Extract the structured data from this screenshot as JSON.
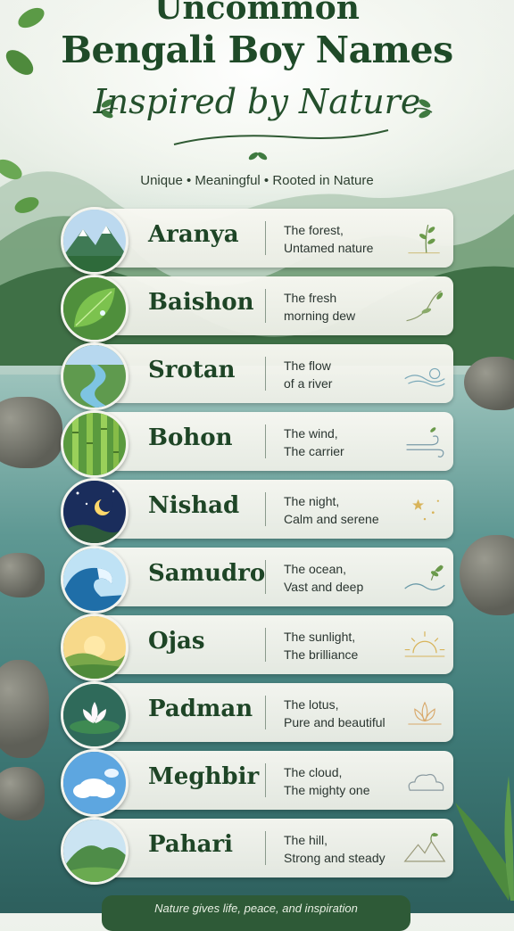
{
  "header": {
    "title_line1": "Uncommon",
    "title_line2": "Bengali Boy Names",
    "title_line3": "Inspired by Nature",
    "tagline": "Unique • Meaningful • Rooted in Nature"
  },
  "names": [
    {
      "name": "Aranya",
      "meaning_line1": "The forest,",
      "meaning_line2": "Untamed nature",
      "image_icon": "mountain-forest-icon",
      "deco_icon": "sprig-icon"
    },
    {
      "name": "Baishon",
      "meaning_line1": "The fresh",
      "meaning_line2": "morning dew",
      "image_icon": "leaf-dew-icon",
      "deco_icon": "vine-icon"
    },
    {
      "name": "Srotan",
      "meaning_line1": "The flow",
      "meaning_line2": "of a river",
      "image_icon": "river-icon",
      "deco_icon": "wave-swirl-icon"
    },
    {
      "name": "Bohon",
      "meaning_line1": "The wind,",
      "meaning_line2": "The carrier",
      "image_icon": "bamboo-icon",
      "deco_icon": "wind-icon"
    },
    {
      "name": "Nishad",
      "meaning_line1": "The night,",
      "meaning_line2": "Calm and serene",
      "image_icon": "moon-night-icon",
      "deco_icon": "stars-icon"
    },
    {
      "name": "Samudro",
      "meaning_line1": "The ocean,",
      "meaning_line2": "Vast and deep",
      "image_icon": "ocean-wave-icon",
      "deco_icon": "wave-leaf-icon"
    },
    {
      "name": "Ojas",
      "meaning_line1": "The sunlight,",
      "meaning_line2": "The brilliance",
      "image_icon": "sunrise-icon",
      "deco_icon": "sun-rays-icon"
    },
    {
      "name": "Padman",
      "meaning_line1": "The lotus,",
      "meaning_line2": "Pure and beautiful",
      "image_icon": "lotus-icon",
      "deco_icon": "lotus-outline-icon"
    },
    {
      "name": "Meghbir",
      "meaning_line1": "The cloud,",
      "meaning_line2": "The mighty one",
      "image_icon": "cloud-sky-icon",
      "deco_icon": "cloud-outline-icon"
    },
    {
      "name": "Pahari",
      "meaning_line1": "The hill,",
      "meaning_line2": "Strong and steady",
      "image_icon": "hill-icon",
      "deco_icon": "mountain-outline-icon"
    }
  ],
  "footer": {
    "text": "Nature gives life, peace, and inspiration"
  },
  "colors": {
    "title": "#1f4a28",
    "card": "#f2f3ec",
    "footer": "#2e5a37"
  }
}
